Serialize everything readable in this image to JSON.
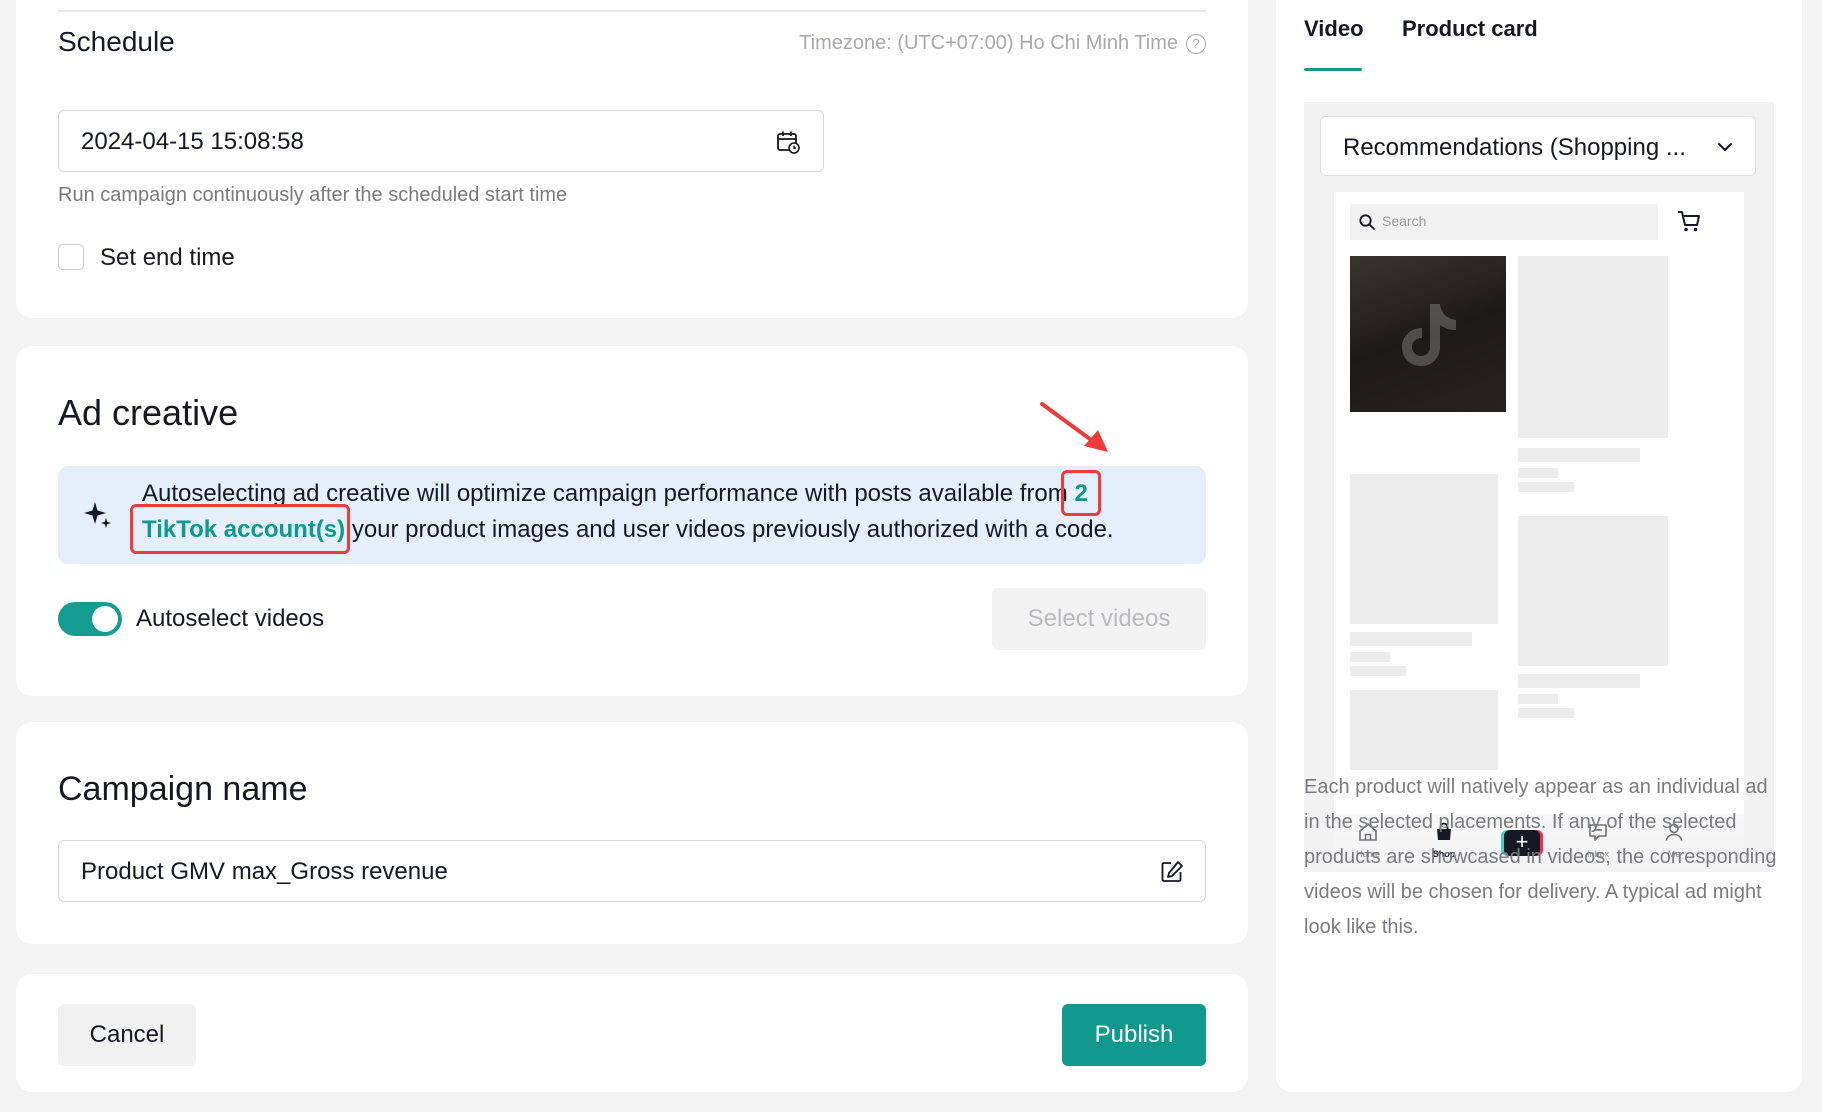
{
  "schedule": {
    "title": "Schedule",
    "timezone": "Timezone: (UTC+07:00) Ho Chi Minh Time",
    "start_value": "2024-04-15 15:08:58",
    "note": "Run campaign continuously after the scheduled start time",
    "end_time_label": "Set end time",
    "end_time_checked": false
  },
  "ad_creative": {
    "title": "Ad creative",
    "banner_text_1": "Autoselecting ad creative will optimize campaign performance with posts available from",
    "account_count": "2",
    "account_link": "TikTok account(s)",
    "banner_text_2": "your product images and user videos previously authorized with a code.",
    "autoselect_label": "Autoselect videos",
    "autoselect_on": true,
    "select_videos_label": "Select videos"
  },
  "campaign_name": {
    "title": "Campaign name",
    "value": "Product GMV max_Gross revenue"
  },
  "footer": {
    "cancel_label": "Cancel",
    "publish_label": "Publish"
  },
  "preview": {
    "tabs": [
      {
        "label": "Video",
        "active": true
      },
      {
        "label": "Product card",
        "active": false
      }
    ],
    "placement": "Recommendations (Shopping ...",
    "search_placeholder": "Search",
    "nav": [
      "Home",
      "Shop",
      "Inbox",
      "Me"
    ],
    "description": "Each product will natively appear as an individual ad in the selected placements. If any of the selected products are showcased in videos, the corresponding videos will be chosen for delivery. A typical ad might look like this."
  },
  "colors": {
    "accent": "#10998c",
    "highlight": "#ef3b3b",
    "banner_bg": "#e5eefb"
  }
}
